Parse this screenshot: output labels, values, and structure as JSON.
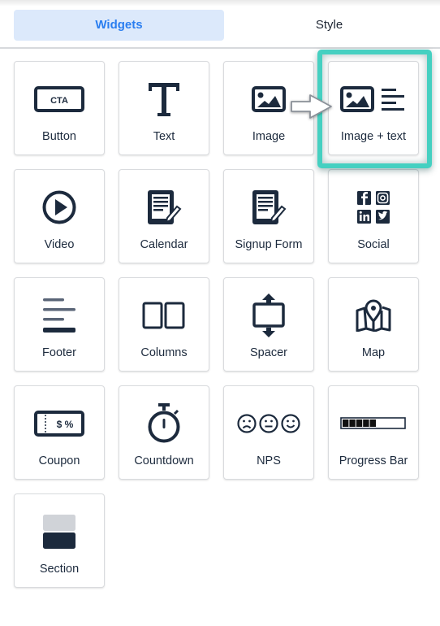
{
  "tabs": [
    {
      "label": "Widgets",
      "active": true
    },
    {
      "label": "Style",
      "active": false
    }
  ],
  "colors": {
    "accent": "#2a7ef0",
    "active_tab_bg": "#dce9fb",
    "highlight": "#45d0c1",
    "icon": "#1c2a3d"
  },
  "widgets": [
    {
      "label": "Button",
      "icon": "cta-button-icon",
      "icon_text": "CTA"
    },
    {
      "label": "Text",
      "icon": "text-t-icon"
    },
    {
      "label": "Image",
      "icon": "image-icon"
    },
    {
      "label": "Image + text",
      "icon": "image-text-icon",
      "highlighted": true
    },
    {
      "label": "Video",
      "icon": "play-circle-icon"
    },
    {
      "label": "Calendar",
      "icon": "document-pencil-icon"
    },
    {
      "label": "Signup Form",
      "icon": "document-pencil-icon"
    },
    {
      "label": "Social",
      "icon": "social-icons-icon"
    },
    {
      "label": "Footer",
      "icon": "footer-lines-icon"
    },
    {
      "label": "Columns",
      "icon": "columns-icon"
    },
    {
      "label": "Spacer",
      "icon": "spacer-arrows-icon"
    },
    {
      "label": "Map",
      "icon": "map-pin-icon"
    },
    {
      "label": "Coupon",
      "icon": "coupon-icon",
      "icon_text": "$ %"
    },
    {
      "label": "Countdown",
      "icon": "stopwatch-icon"
    },
    {
      "label": "NPS",
      "icon": "faces-icon"
    },
    {
      "label": "Progress Bar",
      "icon": "progress-bar-icon",
      "progress_segments_filled": 5,
      "progress_fraction": 0.55
    },
    {
      "label": "Section",
      "icon": "section-blocks-icon"
    }
  ]
}
